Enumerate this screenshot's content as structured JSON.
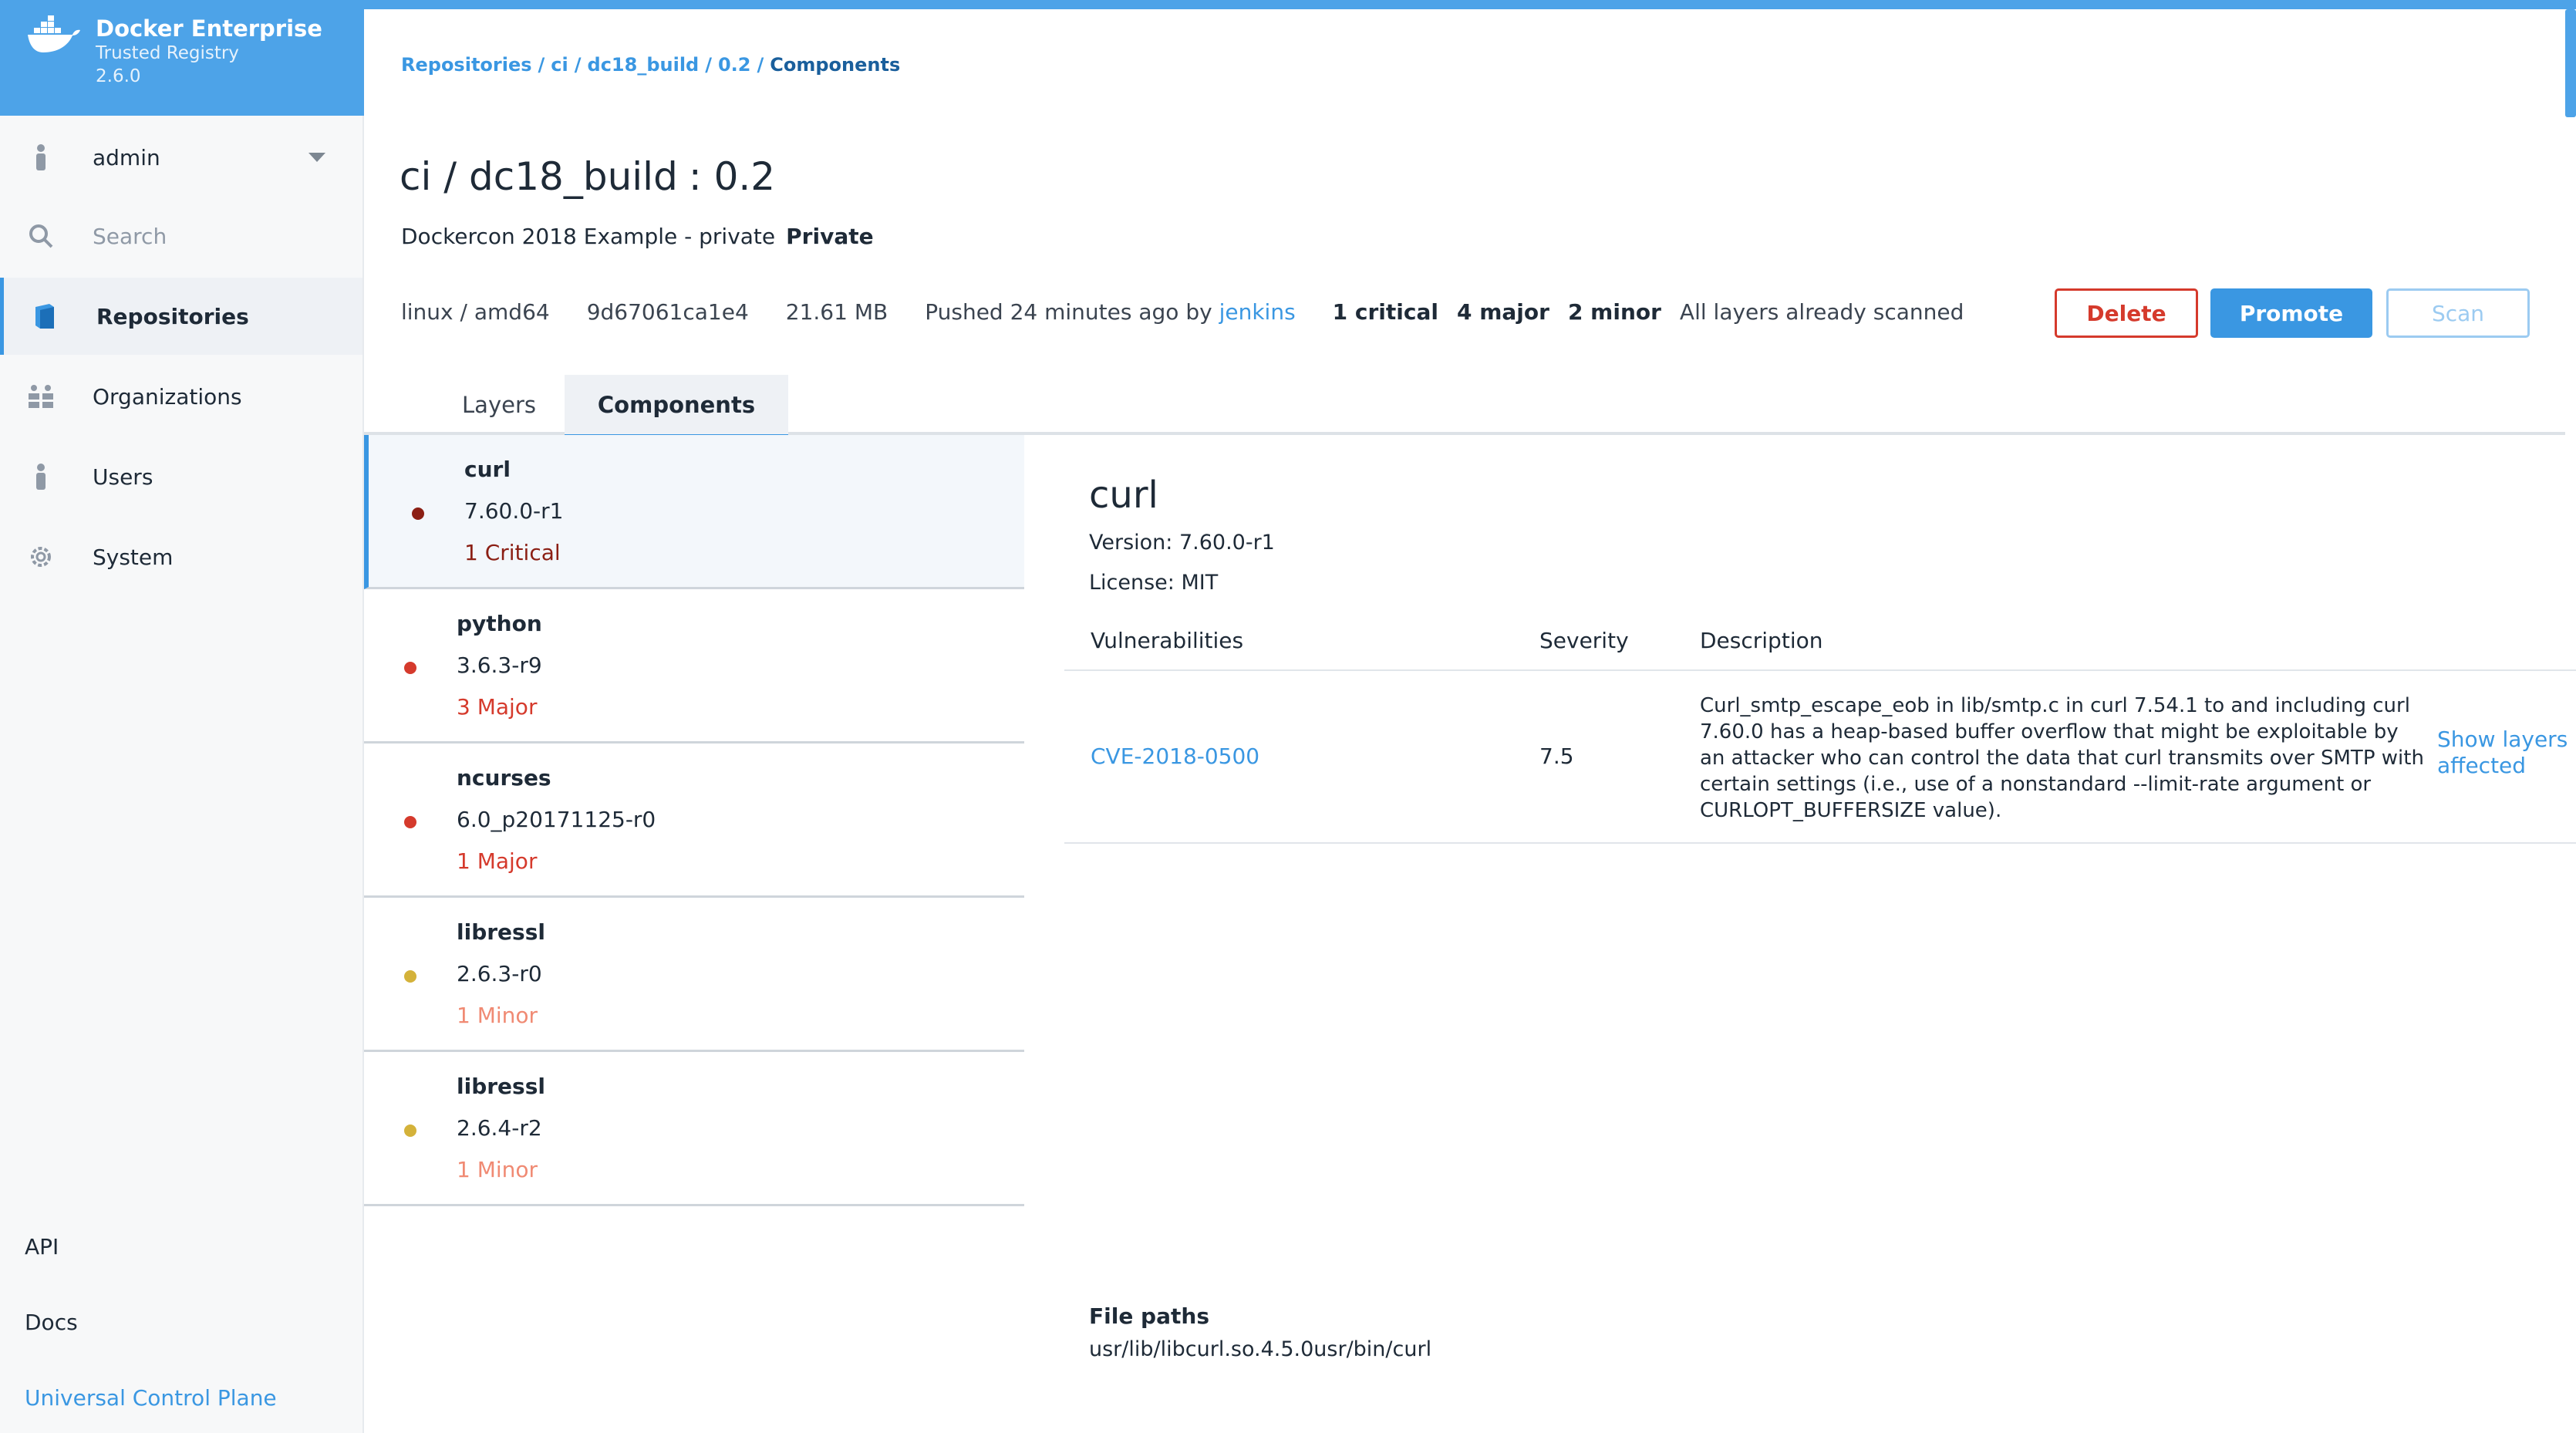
{
  "brand": {
    "title": "Docker Enterprise",
    "subtitle": "Trusted Registry",
    "version": "2.6.0"
  },
  "sidebar": {
    "user": "admin",
    "search_placeholder": "Search",
    "items": [
      {
        "label": "Repositories",
        "icon": "book-icon",
        "active": true
      },
      {
        "label": "Organizations",
        "icon": "group-icon"
      },
      {
        "label": "Users",
        "icon": "user-icon"
      },
      {
        "label": "System",
        "icon": "gear-icon"
      }
    ],
    "footer": {
      "api": "API",
      "docs": "Docs",
      "ucp": "Universal Control Plane"
    }
  },
  "breadcrumb": {
    "b1": "Repositories",
    "b2": "ci",
    "b3": "dc18_build",
    "b4": "0.2",
    "current": "Components",
    "sep": "/"
  },
  "header": {
    "repo": "ci / dc18_build",
    "tag": ": 0.2",
    "description": "Dockercon 2018 Example - private",
    "visibility": "Private"
  },
  "meta": {
    "platform": "linux / amd64",
    "digest": "9d67061ca1e4",
    "size": "21.61 MB",
    "pushed": "Pushed 24 minutes ago by",
    "pusher": "jenkins",
    "critical": "1 critical",
    "major": "4 major",
    "minor": "2 minor",
    "scan_status": "All layers already scanned"
  },
  "actions": {
    "delete": "Delete",
    "promote": "Promote",
    "scan": "Scan"
  },
  "tabs": {
    "layers": "Layers",
    "components": "Components"
  },
  "components": [
    {
      "name": "curl",
      "version": "7.60.0-r1",
      "severity": "1 Critical",
      "color": "#8b1f14"
    },
    {
      "name": "python",
      "version": "3.6.3-r9",
      "severity": "3 Major",
      "color": "#d53a2c"
    },
    {
      "name": "ncurses",
      "version": "6.0_p20171125-r0",
      "severity": "1 Major",
      "color": "#d53a2c"
    },
    {
      "name": "libressl",
      "version": "2.6.3-r0",
      "severity": "1 Minor",
      "color": "#f08a73",
      "dot": "#d4b23a"
    },
    {
      "name": "libressl",
      "version": "2.6.4-r2",
      "severity": "1 Minor",
      "color": "#f08a73",
      "dot": "#d4b23a"
    }
  ],
  "detail": {
    "title": "curl",
    "version": "Version: 7.60.0-r1",
    "license": "License: MIT",
    "headers": {
      "vuln": "Vulnerabilities",
      "severity": "Severity",
      "description": "Description"
    },
    "vulnerability": {
      "id": "CVE-2018-0500",
      "score": "7.5",
      "text": "Curl_smtp_escape_eob in lib/smtp.c in curl 7.54.1 to and including curl 7.60.0 has a heap-based buffer overflow that might be exploitable by an attacker who can control the data that curl transmits over SMTP with certain settings (i.e., use of a nonstandard --limit-rate argument or CURLOPT_BUFFERSIZE value).",
      "action": "Show layers affected"
    },
    "file_paths_label": "File paths",
    "file_paths": "usr/lib/libcurl.so.4.5.0usr/bin/curl"
  }
}
